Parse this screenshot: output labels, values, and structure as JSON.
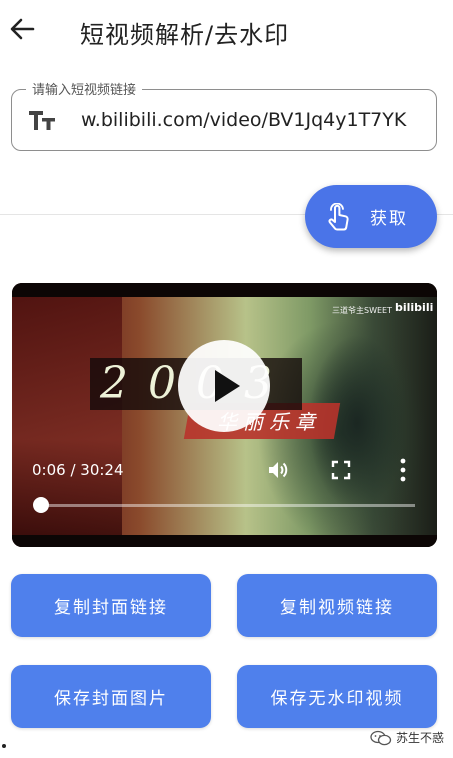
{
  "header": {
    "back_icon": "arrow-left-icon",
    "title": "短视频解析/去水印"
  },
  "url_input": {
    "label": "请输入短视频链接",
    "icon": "text-format-icon",
    "value": "w.bilibili.com/video/BV1Jq4y1T7YK"
  },
  "fetch_button": {
    "icon": "touch-hand-icon",
    "label": "获取"
  },
  "video": {
    "overlay_year": "2003",
    "overlay_subtitle": "华丽乐章",
    "uploader_text": "三道爷主SWEET",
    "logo_text": "bilibili",
    "current_time": "0:06",
    "separator": " / ",
    "duration": "30:24",
    "progress": 0.003,
    "icons": [
      "play-icon",
      "volume-icon",
      "fullscreen-icon",
      "more-vert-icon"
    ]
  },
  "actions": {
    "copy_cover": "复制封面链接",
    "copy_video": "复制视频链接",
    "save_cover": "保存封面图片",
    "save_video": "保存无水印视频"
  },
  "watermark": {
    "icon": "wechat-icon",
    "text": "苏生不惑"
  },
  "colors": {
    "primary": "#4a74e8",
    "button": "#4f80ec"
  }
}
